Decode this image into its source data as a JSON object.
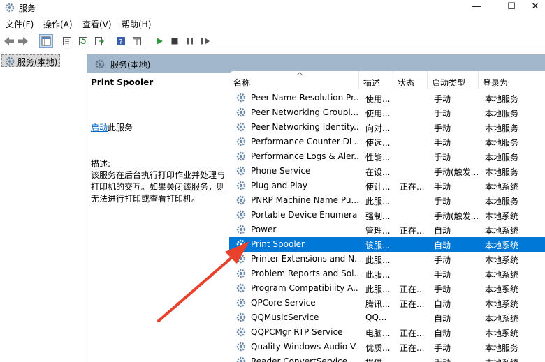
{
  "window": {
    "title": "服务",
    "minimize": "—",
    "maximize": "☐",
    "close": "✕"
  },
  "menu": [
    "文件(F)",
    "操作(A)",
    "查看(V)",
    "帮助(H)"
  ],
  "tree": {
    "root_label": "服务(本地)"
  },
  "panel": {
    "header_title": "服务(本地)"
  },
  "details": {
    "service_name": "Print Spooler",
    "start_link": "启动",
    "start_suffix": "此服务",
    "description_label": "描述:",
    "description_text": "该服务在后台执行打印作业并处理与打印机的交互。如果关闭该服务，则无法进行打印或查看打印机。"
  },
  "columns": {
    "name": "名称",
    "description": "描述",
    "status": "状态",
    "startup": "启动类型",
    "logon": "登录为"
  },
  "services": [
    {
      "name": "Peer Name Resolution Pr...",
      "desc": "使用...",
      "status": "",
      "startup": "手动",
      "logon": "本地服务"
    },
    {
      "name": "Peer Networking Groupi...",
      "desc": "使用...",
      "status": "",
      "startup": "手动",
      "logon": "本地服务"
    },
    {
      "name": "Peer Networking Identity...",
      "desc": "向对...",
      "status": "",
      "startup": "手动",
      "logon": "本地服务"
    },
    {
      "name": "Performance Counter DL...",
      "desc": "使远...",
      "status": "",
      "startup": "手动",
      "logon": "本地服务"
    },
    {
      "name": "Performance Logs & Aler...",
      "desc": "性能...",
      "status": "",
      "startup": "手动",
      "logon": "本地服务"
    },
    {
      "name": "Phone Service",
      "desc": "在设...",
      "status": "",
      "startup": "手动(触发...",
      "logon": "本地服务"
    },
    {
      "name": "Plug and Play",
      "desc": "使计...",
      "status": "正在...",
      "startup": "手动",
      "logon": "本地系统"
    },
    {
      "name": "PNRP Machine Name Pu...",
      "desc": "此服...",
      "status": "",
      "startup": "手动",
      "logon": "本地服务"
    },
    {
      "name": "Portable Device Enumera...",
      "desc": "强制...",
      "status": "",
      "startup": "手动(触发...",
      "logon": "本地系统"
    },
    {
      "name": "Power",
      "desc": "管理...",
      "status": "正在...",
      "startup": "自动",
      "logon": "本地系统"
    },
    {
      "name": "Print Spooler",
      "desc": "该服...",
      "status": "",
      "startup": "自动",
      "logon": "本地系统",
      "selected": true
    },
    {
      "name": "Printer Extensions and N...",
      "desc": "此服...",
      "status": "",
      "startup": "手动",
      "logon": "本地系统"
    },
    {
      "name": "Problem Reports and Sol...",
      "desc": "此服...",
      "status": "",
      "startup": "手动",
      "logon": "本地系统"
    },
    {
      "name": "Program Compatibility A...",
      "desc": "此服...",
      "status": "正在...",
      "startup": "手动",
      "logon": "本地系统"
    },
    {
      "name": "QPCore Service",
      "desc": "腾讯...",
      "status": "正在...",
      "startup": "自动",
      "logon": "本地系统"
    },
    {
      "name": "QQMusicService",
      "desc": "QQ...",
      "status": "",
      "startup": "自动",
      "logon": "本地系统"
    },
    {
      "name": "QQPCMgr RTP Service",
      "desc": "电脑...",
      "status": "正在...",
      "startup": "自动",
      "logon": "本地系统"
    },
    {
      "name": "Quality Windows Audio V...",
      "desc": "优质...",
      "status": "正在...",
      "startup": "手动",
      "logon": "本地服务"
    },
    {
      "name": "Reader ConvertService",
      "desc": "提供...",
      "status": "",
      "startup": "手动",
      "logon": "本地系统"
    }
  ],
  "colors": {
    "selection": "#0078d7",
    "panel_header": "#a3b7cc",
    "link": "#0066cc",
    "arrow": "#e8412c"
  }
}
